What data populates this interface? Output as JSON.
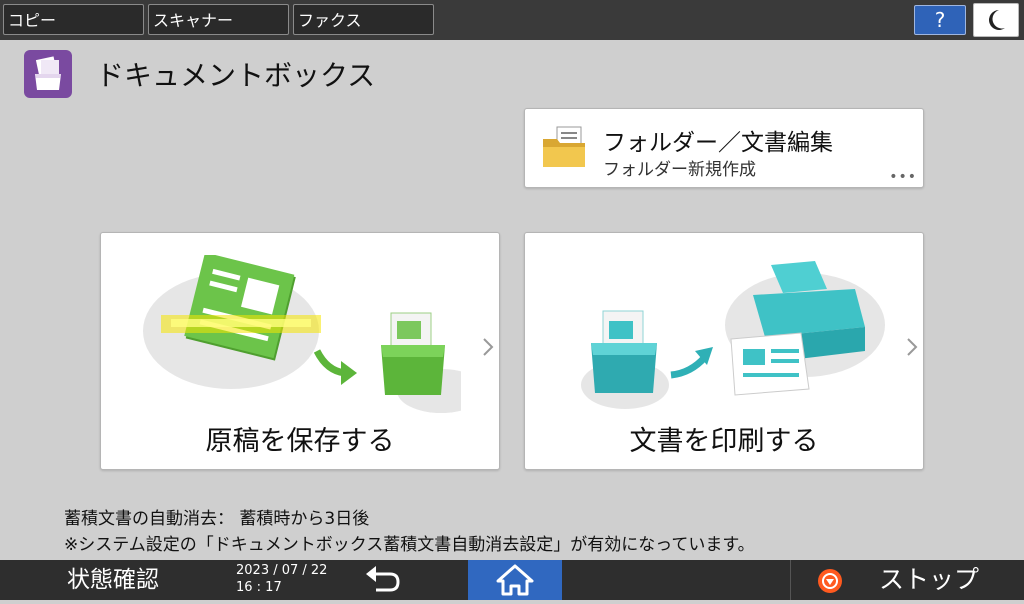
{
  "topbar": {
    "tabs": [
      {
        "label": "コピー"
      },
      {
        "label": "スキャナー"
      },
      {
        "label": "ファクス"
      }
    ],
    "help_label": "?"
  },
  "header": {
    "title": "ドキュメントボックス",
    "icon": "document-box-icon"
  },
  "folder_card": {
    "title": "フォルダー／文書編集",
    "subtitle": "フォルダー新規作成",
    "more": "•••",
    "icon": "folder-icon"
  },
  "actions": {
    "store_label": "原稿を保存する",
    "print_label": "文書を印刷する"
  },
  "info": {
    "line1": "蓄積文書の自動消去： 蓄積時から3日後",
    "line2": "※システム設定の「ドキュメントボックス蓄積文書自動消去設定」が有効になっています。"
  },
  "bottombar": {
    "status_label": "状態確認",
    "date": "2023 / 07 / 22",
    "time": "16 : 17",
    "stop_label": "ストップ"
  },
  "colors": {
    "accent_blue": "#3068c0",
    "app_purple": "#7a4aa0",
    "green": "#5cb53a",
    "teal": "#3fc2c6",
    "stop_orange": "#ff5a1f"
  }
}
